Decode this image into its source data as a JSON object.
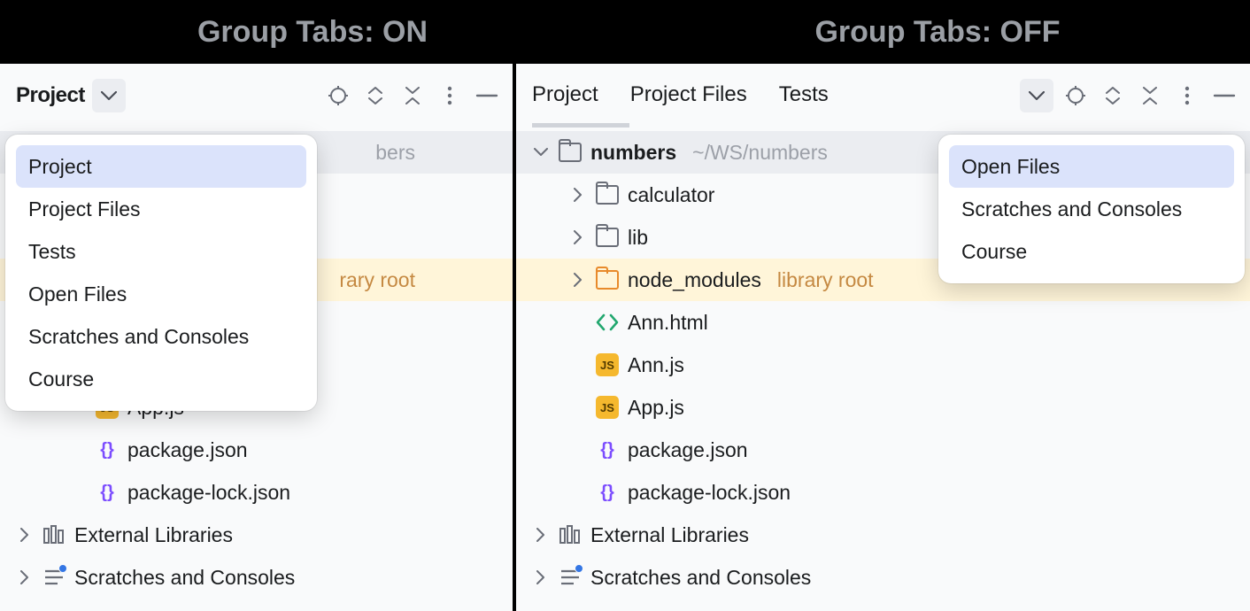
{
  "titles": {
    "left": "Group Tabs: ON",
    "right": "Group Tabs: OFF"
  },
  "left": {
    "header": {
      "title": "Project"
    },
    "popup": {
      "items": [
        "Project",
        "Project Files",
        "Tests",
        "Open Files",
        "Scratches and Consoles",
        "Course"
      ],
      "selected": 0
    },
    "tree": {
      "root": {
        "name": "numbers"
      },
      "library_root_hint": "rary root",
      "files": [
        {
          "kind": "js",
          "name": "App.js"
        },
        {
          "kind": "json",
          "name": "package.json"
        },
        {
          "kind": "json",
          "name": "package-lock.json"
        }
      ],
      "footer": {
        "external": "External Libraries",
        "scratches": "Scratches and Consoles"
      }
    }
  },
  "right": {
    "tabs": {
      "items": [
        "Project",
        "Project Files",
        "Tests"
      ],
      "active": 0
    },
    "popup": {
      "items": [
        "Open Files",
        "Scratches and Consoles",
        "Course"
      ],
      "selected": 0
    },
    "tree": {
      "root": {
        "name": "numbers",
        "path": "~/WS/numbers"
      },
      "children": [
        {
          "kind": "folder",
          "name": "calculator"
        },
        {
          "kind": "folder",
          "name": "lib"
        },
        {
          "kind": "library",
          "name": "node_modules",
          "hint": "library root"
        },
        {
          "kind": "html",
          "name": "Ann.html"
        },
        {
          "kind": "js",
          "name": "Ann.js"
        },
        {
          "kind": "js",
          "name": "App.js"
        },
        {
          "kind": "json",
          "name": "package.json"
        },
        {
          "kind": "json",
          "name": "package-lock.json"
        }
      ],
      "footer": {
        "external": "External Libraries",
        "scratches": "Scratches and Consoles"
      }
    }
  },
  "icons": {
    "chevron_down": "chevron-down-icon",
    "target": "target-icon",
    "expand": "expand-icon",
    "collapse": "collapse-icon",
    "more": "more-icon",
    "minimize": "minimize-icon",
    "js": "JS",
    "json_glyph": "{}"
  }
}
